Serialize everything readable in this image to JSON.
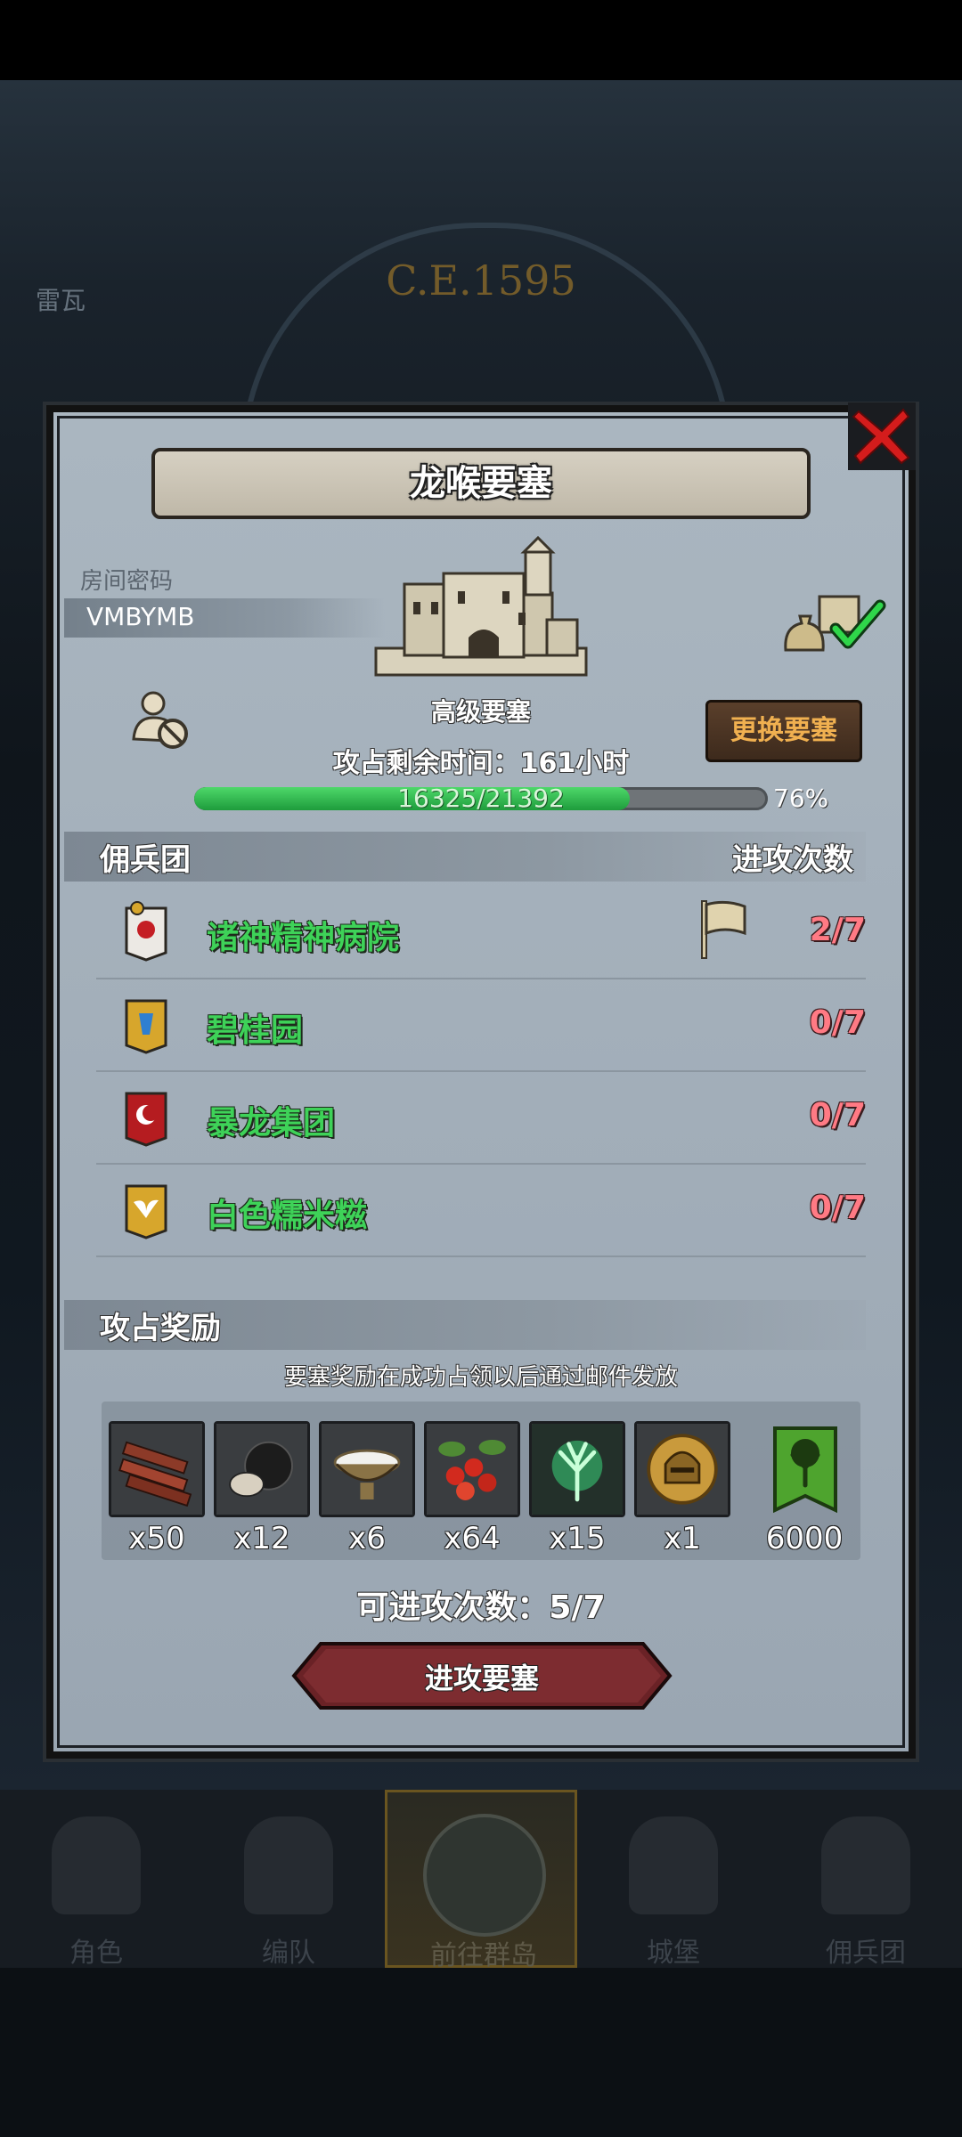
{
  "background": {
    "era": "C.E.1595",
    "top_left_label": "雷瓦"
  },
  "dialog": {
    "title": "龙喉要塞",
    "room_label": "房间密码",
    "room_code": "VMBYMB",
    "fortress_level": "高级要塞",
    "change_button": "更换要塞",
    "time_remaining": "攻占剩余时间：161小时",
    "progress": {
      "current": 16325,
      "total": 21392,
      "text": "16325/21392",
      "percent_text": "76%",
      "fraction": 0.76
    },
    "mercenary_header": "佣兵团",
    "attack_count_header": "进攻次数",
    "mercenaries": [
      {
        "name": "诸神精神病院",
        "count": "2/7",
        "shield_color": "#e8e8e8",
        "has_flag": true
      },
      {
        "name": "碧桂园",
        "count": "0/7",
        "shield_color": "#d7a62c",
        "has_flag": false
      },
      {
        "name": "暴龙集团",
        "count": "0/7",
        "shield_color": "#b51c20",
        "has_flag": false
      },
      {
        "name": "白色糯米糍",
        "count": "0/7",
        "shield_color": "#d7a62c",
        "has_flag": false
      }
    ],
    "reward_header": "攻占奖励",
    "reward_note": "要塞奖励在成功占领以后通过邮件发放",
    "rewards": [
      {
        "icon": "wood-planks-icon",
        "qty": "x50"
      },
      {
        "icon": "truffle-icon",
        "qty": "x12"
      },
      {
        "icon": "salt-bowl-icon",
        "qty": "x6"
      },
      {
        "icon": "berries-icon",
        "qty": "x64"
      },
      {
        "icon": "green-spirit-tree-icon",
        "qty": "x15"
      },
      {
        "icon": "golden-helmet-coin-icon",
        "qty": "x1"
      },
      {
        "icon": "tree-banner-icon",
        "qty": "6000"
      }
    ],
    "attempts": "可进攻次数：5/7",
    "attack_button": "进攻要塞"
  },
  "bottom_nav": [
    {
      "label": "角色",
      "icon": "knight-icon"
    },
    {
      "label": "编队",
      "icon": "helmet-icon"
    },
    {
      "label": "前往群岛",
      "icon": "globe-icon",
      "active": true
    },
    {
      "label": "城堡",
      "icon": "castle-icon"
    },
    {
      "label": "佣兵团",
      "icon": "mercenary-ship-icon"
    }
  ]
}
